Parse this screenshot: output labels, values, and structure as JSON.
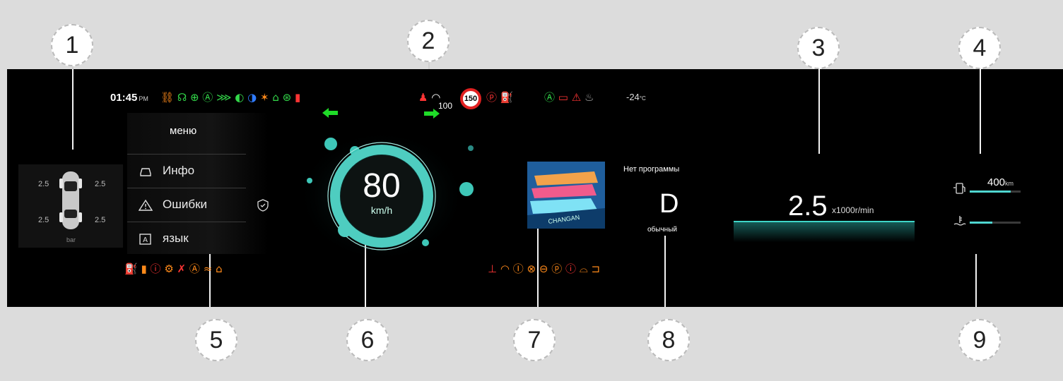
{
  "callouts": [
    "1",
    "2",
    "3",
    "4",
    "5",
    "6",
    "7",
    "8",
    "9"
  ],
  "status": {
    "time": "01:45",
    "ampm": "PM",
    "cruise_speed": "100",
    "speed_limit": "150",
    "outside_temp": "-24",
    "temp_unit": "°C"
  },
  "indicators_top_left": [
    {
      "name": "seatbelt-icon",
      "color": "#ff8a1a"
    },
    {
      "name": "steering-assist-icon",
      "color": "#33d84a"
    },
    {
      "name": "rear-fog-icon",
      "color": "#33d84a"
    },
    {
      "name": "auto-headlight-icon",
      "color": "#33d84a"
    },
    {
      "name": "position-light-icon",
      "color": "#33d84a"
    },
    {
      "name": "low-beam-icon",
      "color": "#33d84a"
    },
    {
      "name": "high-beam-icon",
      "color": "#2f7bff"
    },
    {
      "name": "esp-off-icon",
      "color": "#ff8a1a"
    },
    {
      "name": "lane-assist-icon",
      "color": "#33d84a"
    },
    {
      "name": "steering-wheel-icon",
      "color": "#33d84a"
    },
    {
      "name": "door-open-icon",
      "color": "#ff3434"
    }
  ],
  "indicators_top_right": [
    {
      "name": "auto-hold-icon",
      "color": "#33d84a"
    },
    {
      "name": "battery-icon",
      "color": "#ff3434"
    },
    {
      "name": "pedestrian-warning-icon",
      "color": "#ff3434"
    },
    {
      "name": "seat-heat-icon",
      "color": "#aaaaaa"
    }
  ],
  "tpms": {
    "front_left": "2.5",
    "front_right": "2.5",
    "rear_left": "2.5",
    "rear_right": "2.5",
    "unit": "bar"
  },
  "menu": {
    "title": "меню",
    "items": [
      {
        "label": "Инфо",
        "icon": "car-icon"
      },
      {
        "label": "Ошибки",
        "icon": "warning-icon"
      },
      {
        "label": "язык",
        "icon": "language-icon"
      }
    ]
  },
  "speed": {
    "value": "80",
    "unit": "km/h"
  },
  "media": {
    "status": "Нет программы",
    "album_brand": "CHANGAN"
  },
  "gear": {
    "position": "D",
    "mode": "обычный"
  },
  "rpm": {
    "value": "2.5",
    "unit": "x1000r/min"
  },
  "fuel": {
    "range": "400",
    "range_unit": "km",
    "level": 0.8
  },
  "coolant": {
    "level": 0.45
  }
}
